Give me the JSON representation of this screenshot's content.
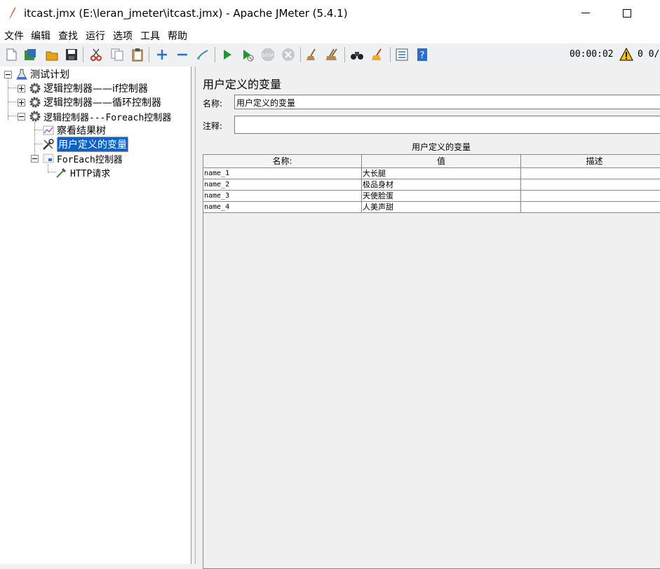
{
  "window": {
    "title": "itcast.jmx (E:\\leran_jmeter\\itcast.jmx) - Apache JMeter (5.4.1)"
  },
  "menu": [
    "文件",
    "编辑",
    "查找",
    "运行",
    "选项",
    "工具",
    "帮助"
  ],
  "toolbar": {
    "icons": [
      "new-icon",
      "templates-icon",
      "open-icon",
      "save-icon",
      "cut-icon",
      "copy-icon",
      "paste-icon",
      "expand-icon",
      "collapse-icon",
      "toggle-icon",
      "start-icon",
      "start-no-pause-icon",
      "stop-icon",
      "shutdown-icon",
      "clear-icon",
      "clear-all-icon",
      "search-icon",
      "reset-search-icon",
      "function-helper-icon",
      "help-icon"
    ],
    "timer": "00:00:02",
    "warnings": "0",
    "threads": "0/"
  },
  "tree": {
    "root": "测试计划",
    "nodes": [
      {
        "label": "逻辑控制器——if控制器",
        "icon": "gear-icon"
      },
      {
        "label": "逻辑控制器——循环控制器",
        "icon": "gear-icon"
      },
      {
        "label": "逻辑控制器---Foreach控制器",
        "icon": "gear-icon"
      },
      {
        "label": "察看结果树",
        "icon": "chart-icon"
      },
      {
        "label": "用户定义的变量",
        "icon": "wrench-icon",
        "selected": true
      },
      {
        "label": "ForEach控制器",
        "icon": "foreach-icon"
      },
      {
        "label": "HTTP请求",
        "icon": "pipette-icon"
      }
    ]
  },
  "panel": {
    "title": "用户定义的变量",
    "name_label": "名称:",
    "name_value": "用户定义的变量",
    "comment_label": "注释:",
    "comment_value": "",
    "table_title": "用户定义的变量",
    "columns": [
      "名称:",
      "值",
      "描述"
    ],
    "rows": [
      [
        "name_1",
        "大长腿",
        ""
      ],
      [
        "name_2",
        "极品身材",
        ""
      ],
      [
        "name_3",
        "天使脸蛋",
        ""
      ],
      [
        "name_4",
        "人美声甜",
        ""
      ]
    ]
  }
}
